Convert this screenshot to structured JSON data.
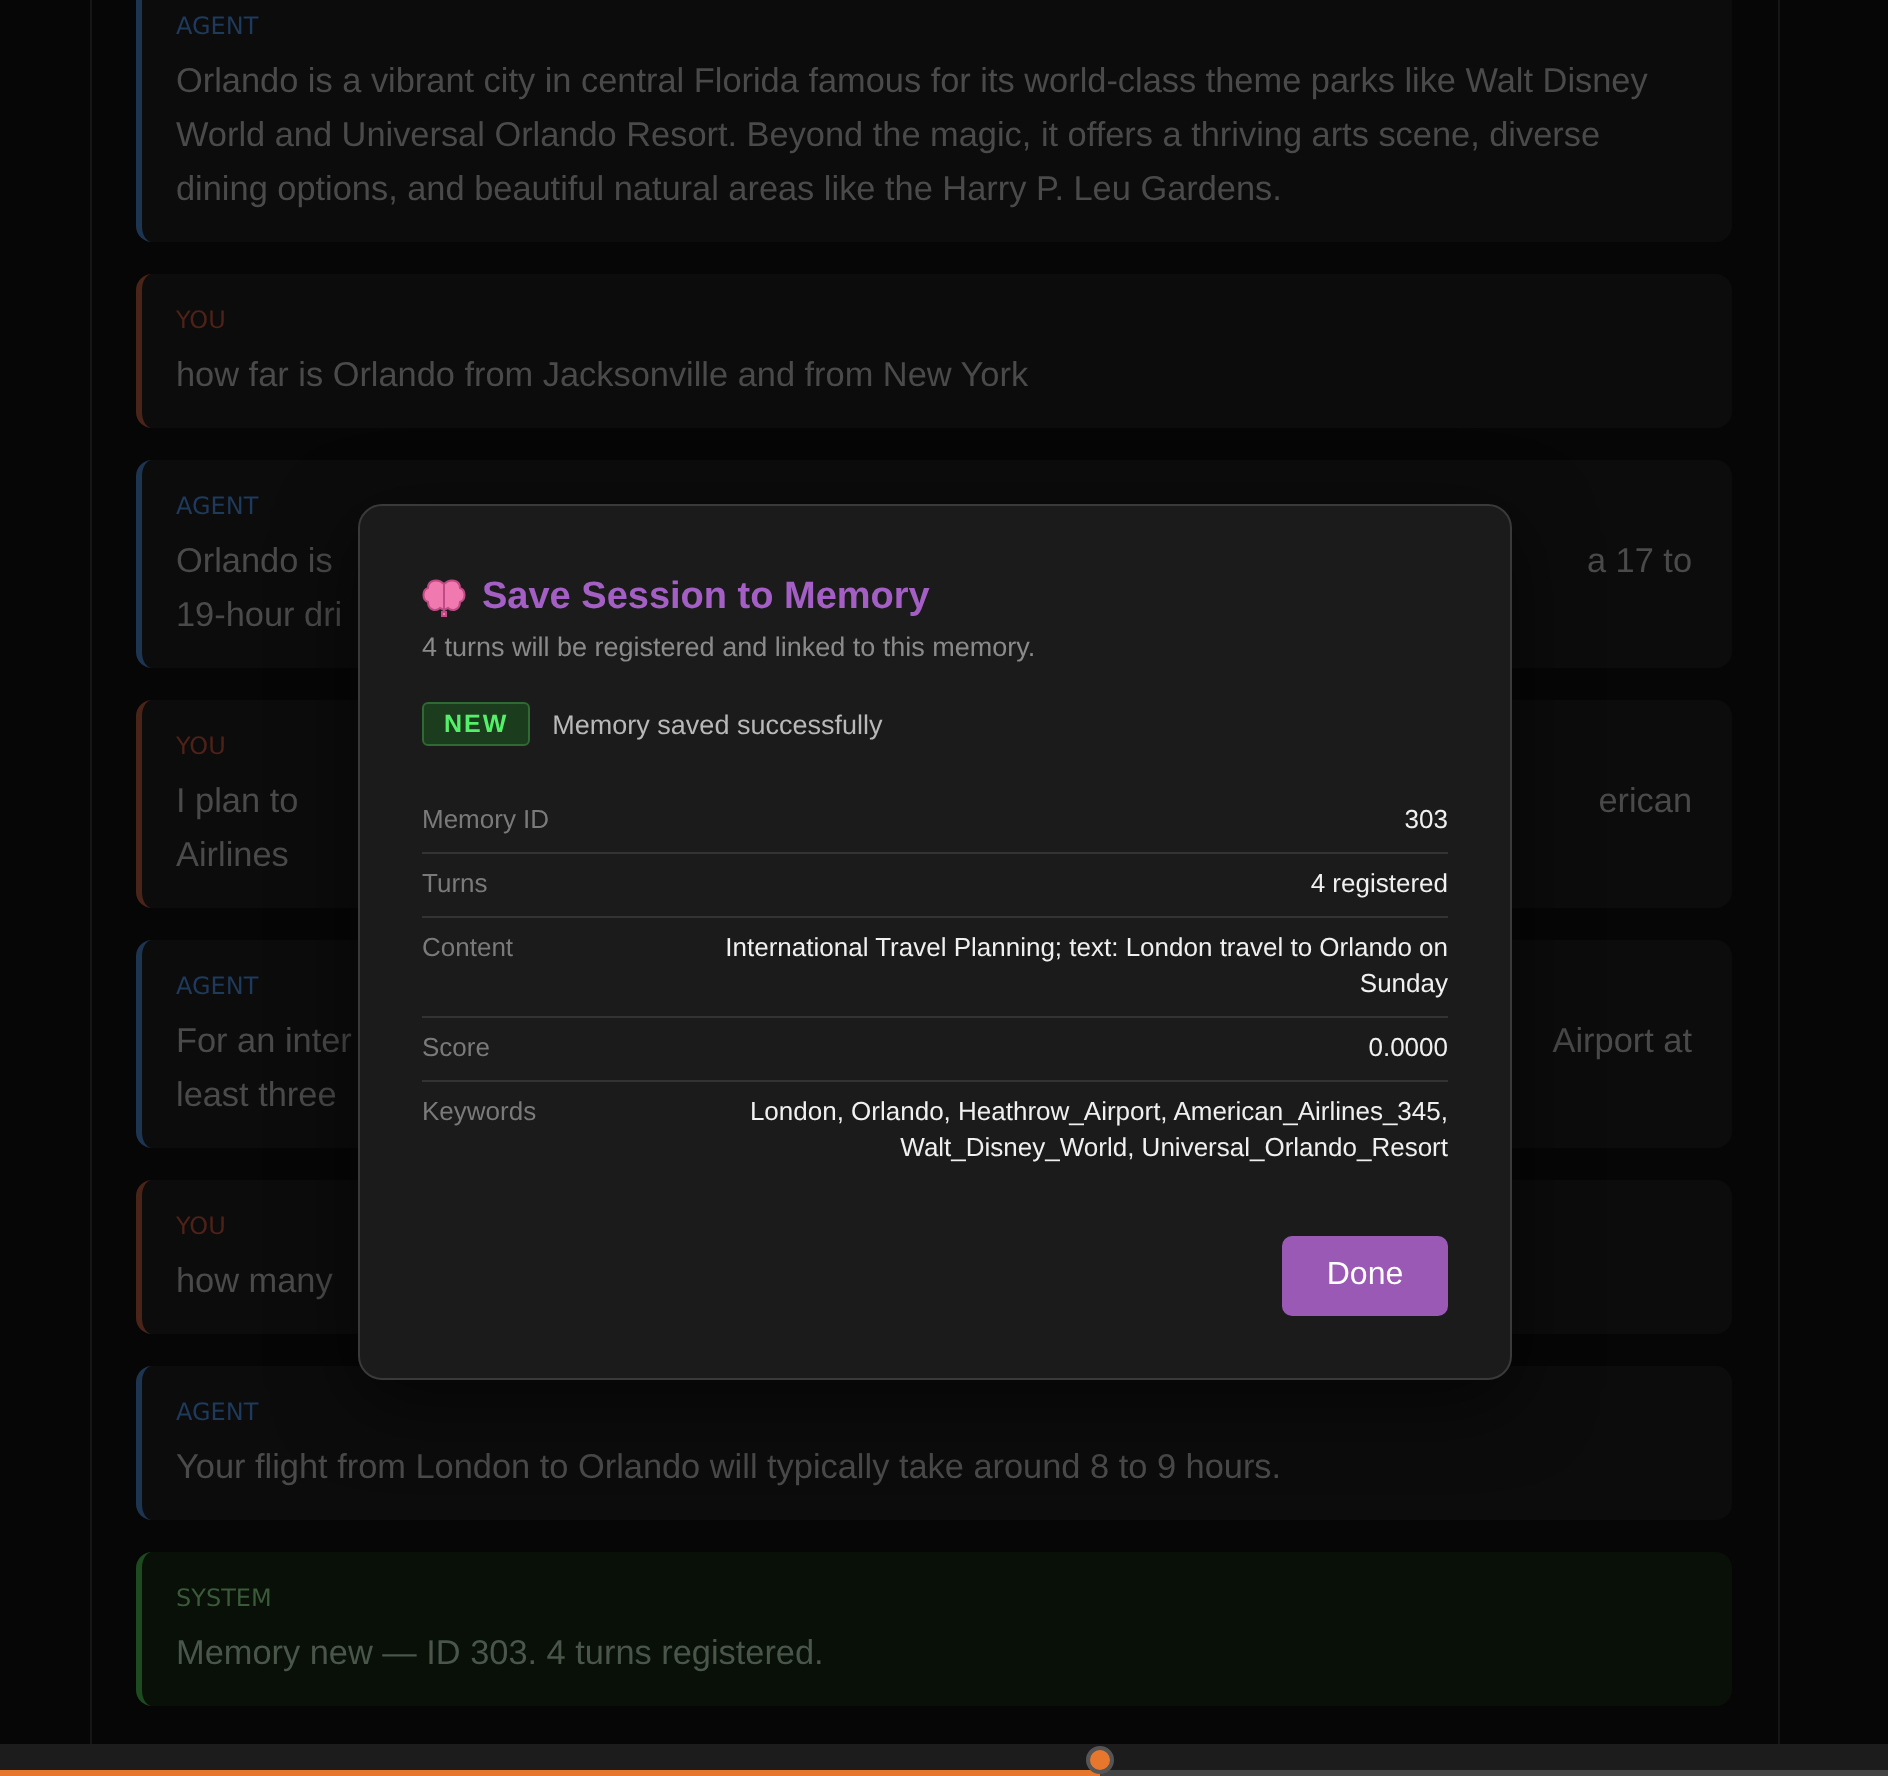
{
  "messages": [
    {
      "kind": "agent",
      "role": "AGENT",
      "lines": [
        {
          "left": "Orlando is a vibrant city in central Florida famous for its world-class theme parks like Walt Disney"
        },
        {
          "left": "World and Universal Orlando Resort. Beyond the magic, it offers a thriving arts scene, diverse"
        },
        {
          "left": "dining options, and beautiful natural areas like the Harry P. Leu Gardens."
        }
      ]
    },
    {
      "kind": "user",
      "role": "YOU",
      "lines": [
        {
          "left": "how far is Orlando from Jacksonville and from New York"
        }
      ]
    },
    {
      "kind": "agent",
      "role": "AGENT",
      "lines": [
        {
          "left": "Orlando is",
          "right": "a 17 to"
        },
        {
          "left": "19-hour dri"
        }
      ]
    },
    {
      "kind": "user",
      "role": "YOU",
      "lines": [
        {
          "left": "I plan to",
          "right": "erican"
        },
        {
          "left": "Airlines"
        }
      ]
    },
    {
      "kind": "agent",
      "role": "AGENT",
      "lines": [
        {
          "left": "For an inter",
          "right": "Airport at"
        },
        {
          "left": "least three"
        }
      ]
    },
    {
      "kind": "user",
      "role": "YOU",
      "lines": [
        {
          "left": "how many"
        }
      ]
    },
    {
      "kind": "agent",
      "role": "AGENT",
      "lines": [
        {
          "left": "Your flight from London to Orlando will typically take around 8 to 9 hours."
        }
      ]
    },
    {
      "kind": "system",
      "role": "SYSTEM",
      "lines": [
        {
          "left": "Memory new — ID 303. 4 turns registered."
        }
      ]
    }
  ],
  "dialog": {
    "title": "Save Session to Memory",
    "subtitle": "4 turns will be registered and linked to this memory.",
    "badge": "NEW",
    "status": "Memory saved successfully",
    "fields": [
      {
        "label": "Memory ID",
        "value": "303"
      },
      {
        "label": "Turns",
        "value": "4 registered"
      },
      {
        "label": "Content",
        "value": "International Travel Planning; text: London travel to Orlando on Sunday"
      },
      {
        "label": "Score",
        "value": "0.0000"
      },
      {
        "label": "Keywords",
        "value": "London, Orlando, Heathrow_Airport, American_Airlines_345, Walt_Disney_World, Universal_Orlando_Resort"
      }
    ],
    "button": "Done"
  },
  "progress": {
    "level": 0.583
  }
}
